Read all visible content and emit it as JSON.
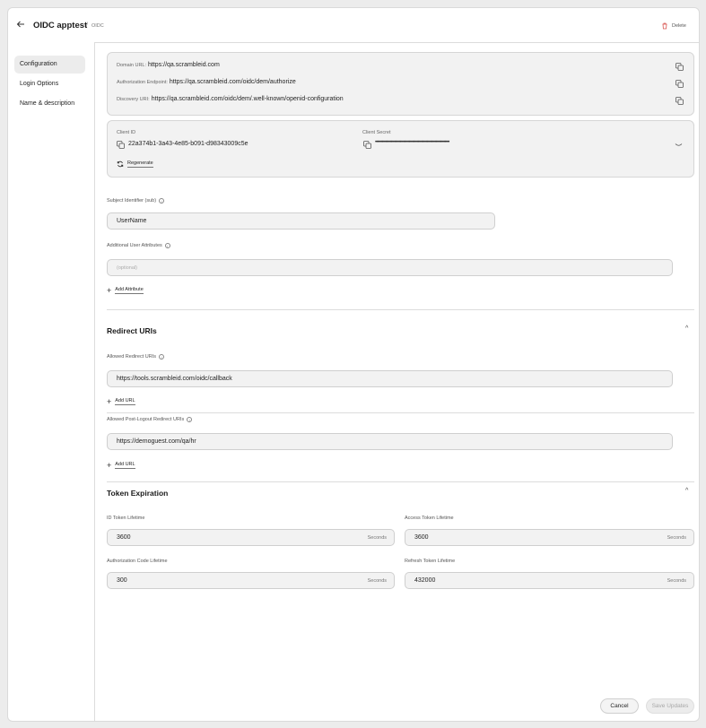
{
  "header": {
    "title": "OIDC apptest",
    "separator": "/",
    "crumb": "OIDC",
    "delete_label": "Delete"
  },
  "sidebar": {
    "items": [
      {
        "label": "Configuration",
        "active": true
      },
      {
        "label": "Login Options"
      },
      {
        "label": "Name & description"
      }
    ]
  },
  "endpoints": {
    "domain_label": "Domain URL",
    "domain_value": "https://qa.scrambleid.com",
    "auth_label": "Authorization Endpoint",
    "auth_value": "https://qa.scrambleid.com/oidc/dem/authorize",
    "discovery_label": "Discovery URI",
    "discovery_value": "https://qa.scrambleid.com/oidc/dem/.well-known/openid-configuration"
  },
  "client": {
    "id_label": "Client ID",
    "id_value": "22a374b1-3a43-4e85-b091-d98343009c5e",
    "secret_label": "Client Secret",
    "secret_value": "••••••••••••••••••••••••••••••••••••••••••••••••••••••••••••••••••",
    "regenerate_label": "Regenerate"
  },
  "subject": {
    "label": "Subject Identifier (sub)",
    "value": "UserName"
  },
  "attributes": {
    "label": "Additional User Attributes",
    "placeholder": "(optional)",
    "add_label": "Add Attribute"
  },
  "redirects": {
    "section_title": "Redirect URIs",
    "allowed_label": "Allowed Redirect URIs",
    "allowed_value": "https://tools.scrambleid.com/oidc/callback",
    "add_url": "Add URL",
    "logout_label": "Allowed Post-Logout Redirect URIs",
    "logout_value": "https://demoguest.com/qa/hr",
    "add_url2": "Add URL"
  },
  "tokens": {
    "section_title": "Token Expiration",
    "id_label": "ID Token Lifetime",
    "id_value": "3600",
    "access_label": "Access Token Lifetime",
    "access_value": "3600",
    "auth_code_label": "Authorization Code Lifetime",
    "auth_code_value": "300",
    "refresh_label": "Refresh Token Lifetime",
    "refresh_value": "432000",
    "unit": "Seconds"
  },
  "footer": {
    "cancel_label": "Cancel",
    "save_label": "Save Updates"
  }
}
